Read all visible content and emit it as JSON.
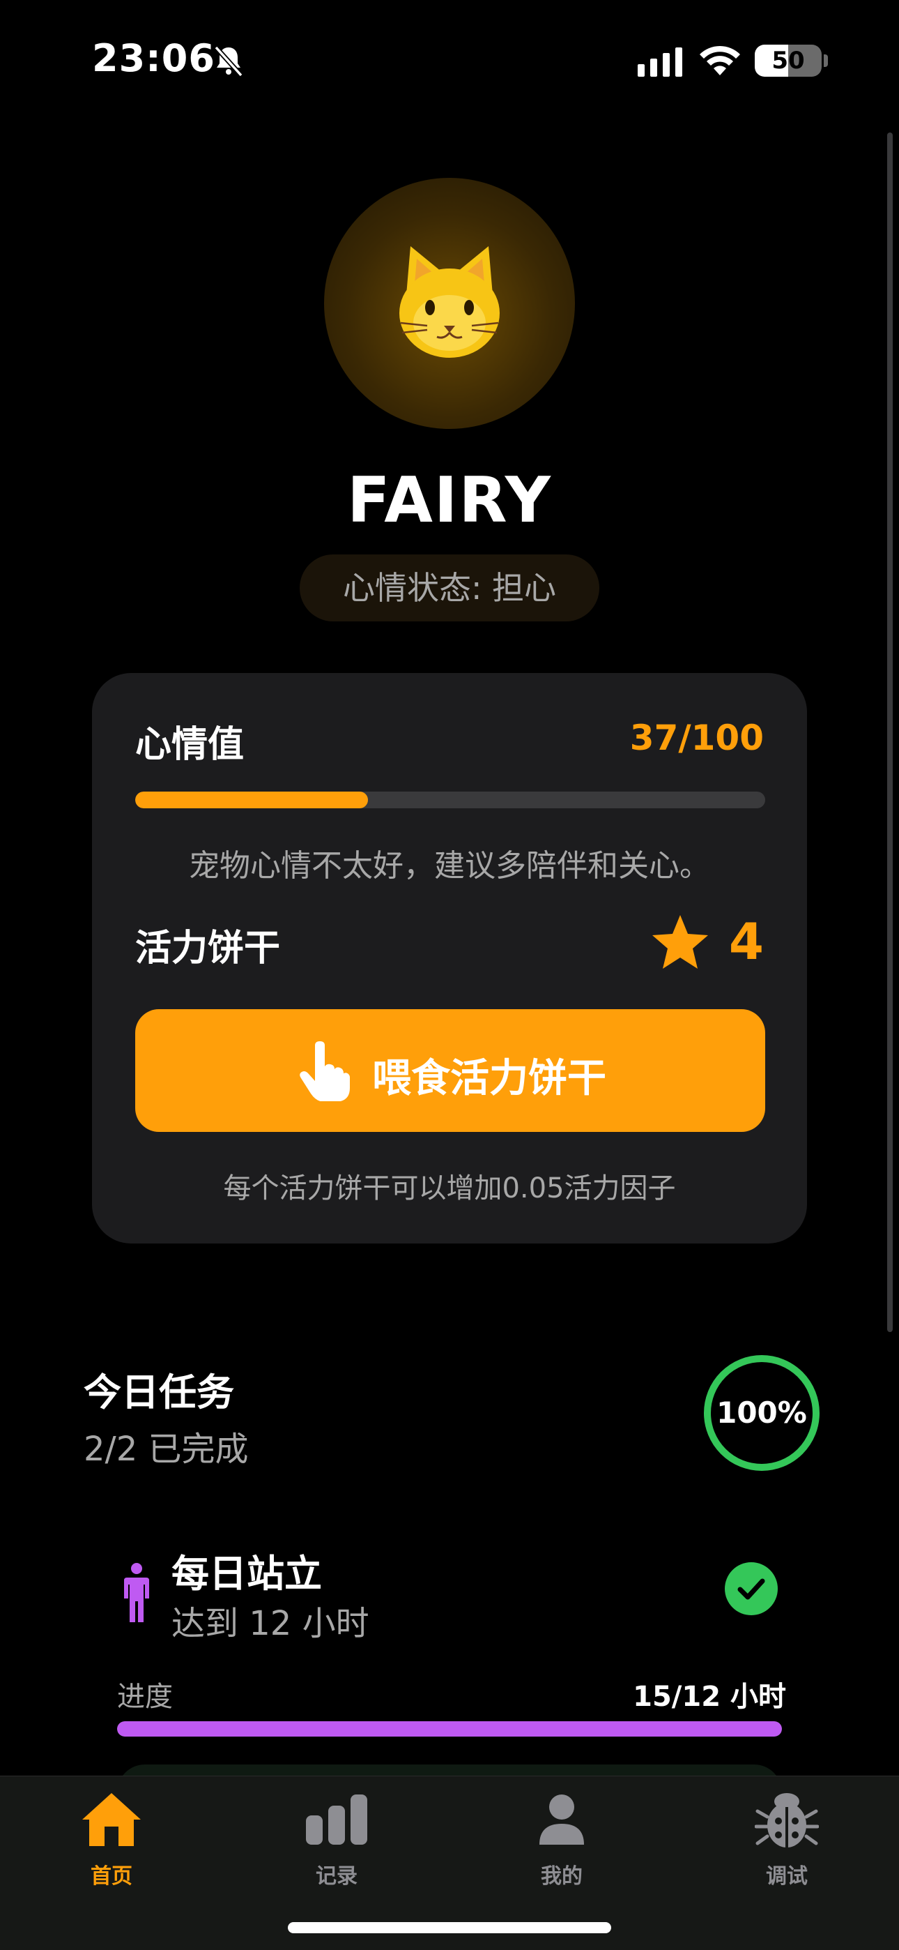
{
  "status_bar": {
    "time": "23:06",
    "battery": "50"
  },
  "pet": {
    "name": "FAIRY",
    "mood_status": "心情状态: 担心"
  },
  "mood_card": {
    "label": "心情值",
    "value_text": "37/100",
    "value": 37,
    "max": 100,
    "message": "宠物心情不太好，建议多陪伴和关心。",
    "biscuit_label": "活力饼干",
    "biscuit_count": "4",
    "feed_button_label": "喂食活力饼干",
    "feed_note": "每个活力饼干可以增加0.05活力因子"
  },
  "tasks": {
    "title": "今日任务",
    "summary": "2/2 已完成",
    "percent_text": "100%",
    "items": [
      {
        "name": "每日站立",
        "goal": "达到 12 小时",
        "progress_label": "进度",
        "progress_text": "15/12 小时",
        "progress_fraction": 1.0,
        "completed": true,
        "icon": "person-standing-icon"
      }
    ]
  },
  "tab_bar": {
    "items": [
      {
        "label": "首页",
        "icon": "home-icon",
        "active": true
      },
      {
        "label": "记录",
        "icon": "chart-bars-icon",
        "active": false
      },
      {
        "label": "我的",
        "icon": "person-icon",
        "active": false
      },
      {
        "label": "调试",
        "icon": "bug-icon",
        "active": false
      }
    ]
  },
  "colors": {
    "accent": "#ff9f0a",
    "success": "#34c759",
    "purple": "#bf5af2",
    "card": "#1c1c1e"
  }
}
